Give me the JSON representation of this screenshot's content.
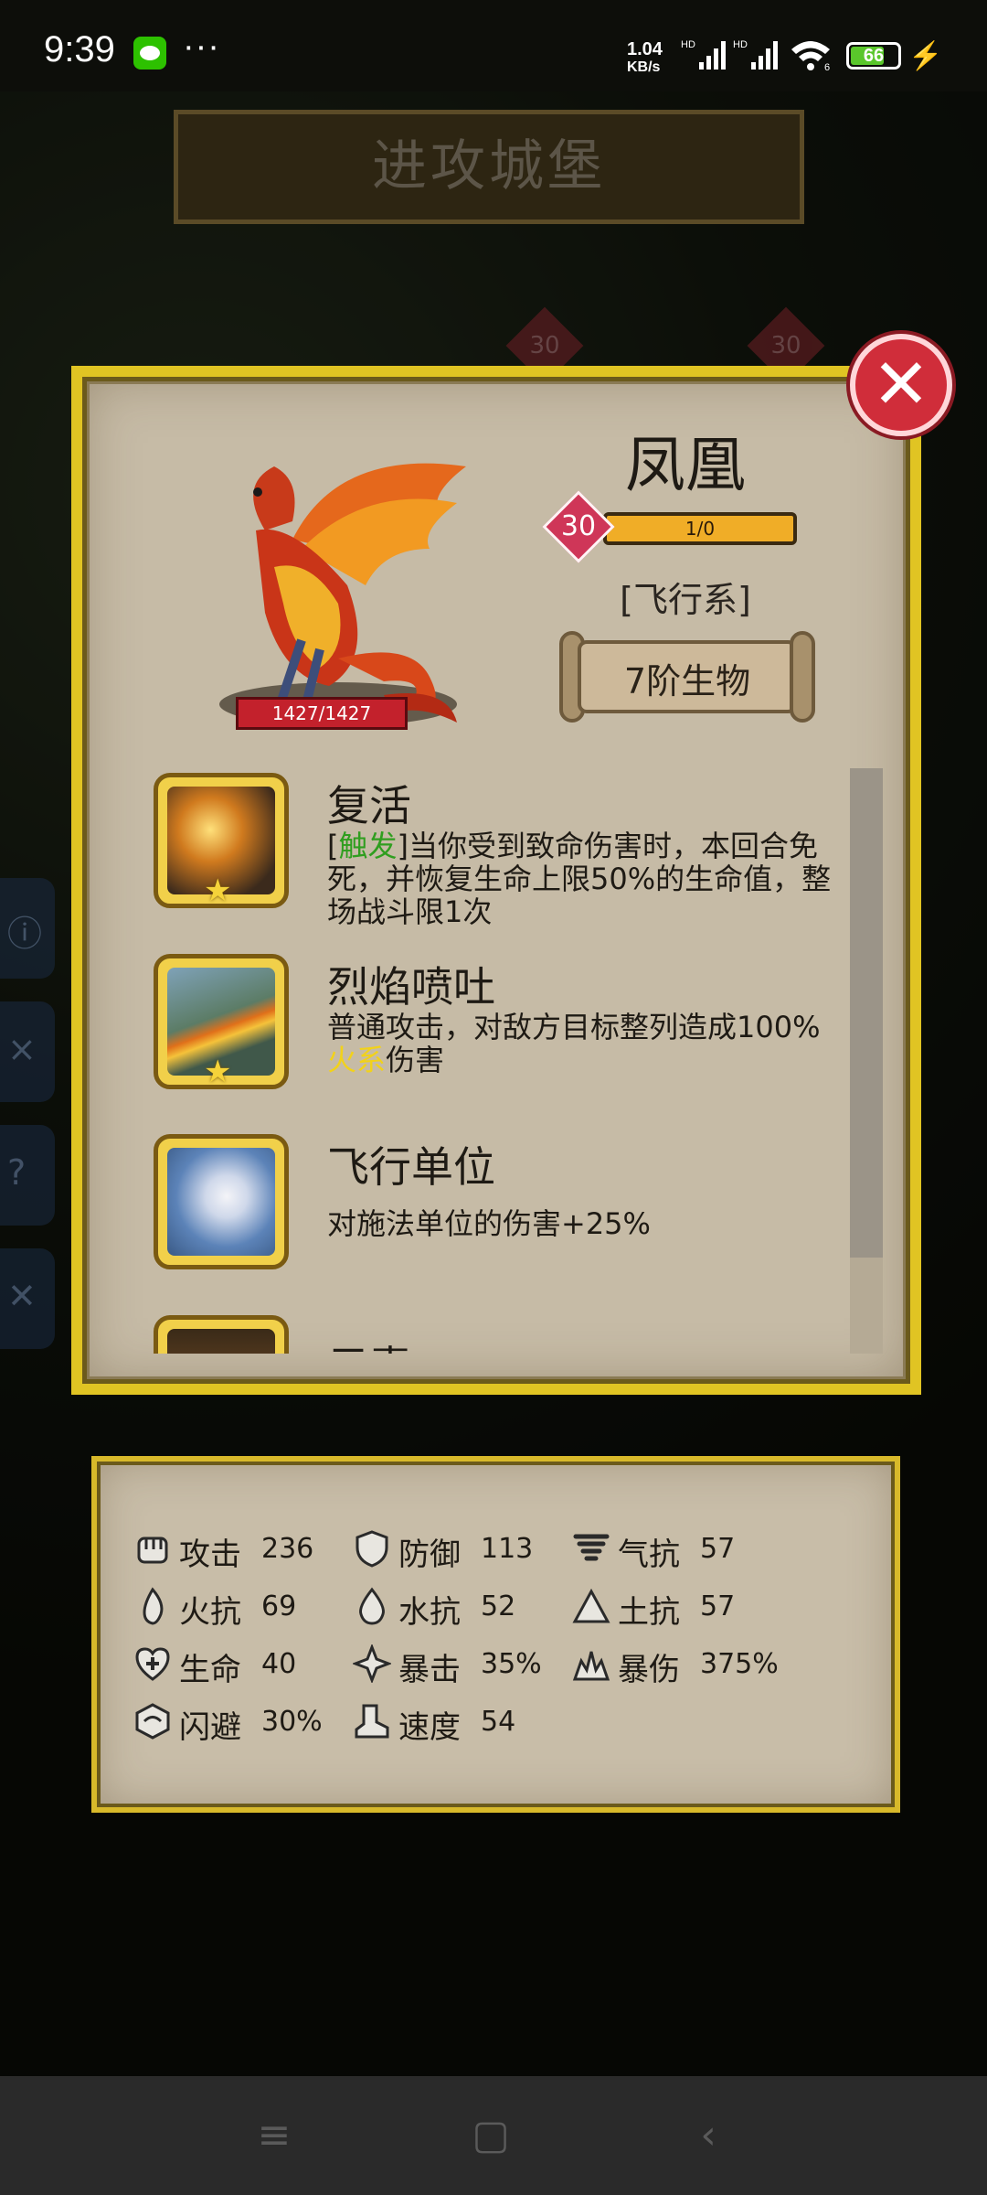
{
  "statusbar": {
    "time": "9:39",
    "dots": "···",
    "speed_value": "1.04",
    "speed_unit": "KB/s",
    "signal1_label": "HD",
    "signal2_label": "HD",
    "wifi_label": "6",
    "battery_level": "66"
  },
  "screen_title": "进攻城堡",
  "bg_tags": [
    "30",
    "30"
  ],
  "unit": {
    "name": "凤凰",
    "level": "30",
    "xp": "1/0",
    "type": "[飞行系]",
    "tier": "7阶生物",
    "hp": "1427/1427"
  },
  "skills": [
    {
      "name": "复活",
      "desc_prefix": "[",
      "desc_highlight": "触发",
      "desc_rest": "]当你受到致命伤害时，本回合免死，并恢复生命上限50%的生命值，整场战斗限1次",
      "icon": "phoenix-rebirth-icon"
    },
    {
      "name": "烈焰喷吐",
      "desc_prefix": "普通攻击，对敌方目标整列造成100%",
      "desc_highlight": "火系",
      "desc_rest": "伤害",
      "icon": "fire-breath-icon"
    },
    {
      "name": "飞行单位",
      "desc": "对施法单位的伤害+25%",
      "icon": "pegasus-icon"
    },
    {
      "name": "元素",
      "icon": "castle-icon"
    }
  ],
  "stats": [
    {
      "label": "攻击",
      "value": "236",
      "icon": "fist-icon"
    },
    {
      "label": "防御",
      "value": "113",
      "icon": "shield-icon"
    },
    {
      "label": "气抗",
      "value": "57",
      "icon": "tornado-icon"
    },
    {
      "label": "火抗",
      "value": "69",
      "icon": "flame-icon"
    },
    {
      "label": "水抗",
      "value": "52",
      "icon": "water-drop-icon"
    },
    {
      "label": "土抗",
      "value": "57",
      "icon": "earth-icon"
    },
    {
      "label": "生命",
      "value": "40",
      "icon": "heart-plus-icon"
    },
    {
      "label": "暴击",
      "value": "35%",
      "icon": "crit-icon"
    },
    {
      "label": "暴伤",
      "value": "375%",
      "icon": "crit-damage-icon"
    },
    {
      "label": "闪避",
      "value": "30%",
      "icon": "dodge-icon"
    },
    {
      "label": "速度",
      "value": "54",
      "icon": "boot-icon"
    }
  ],
  "colors": {
    "frame_gold": "#e0c423",
    "parchment": "#c6bba6",
    "close_red": "#d02d3a",
    "hp_red": "#c3212c",
    "xp_orange": "#f0ad27",
    "trigger_green": "#2f9e1f",
    "fire_yellow": "#f2d21a"
  }
}
